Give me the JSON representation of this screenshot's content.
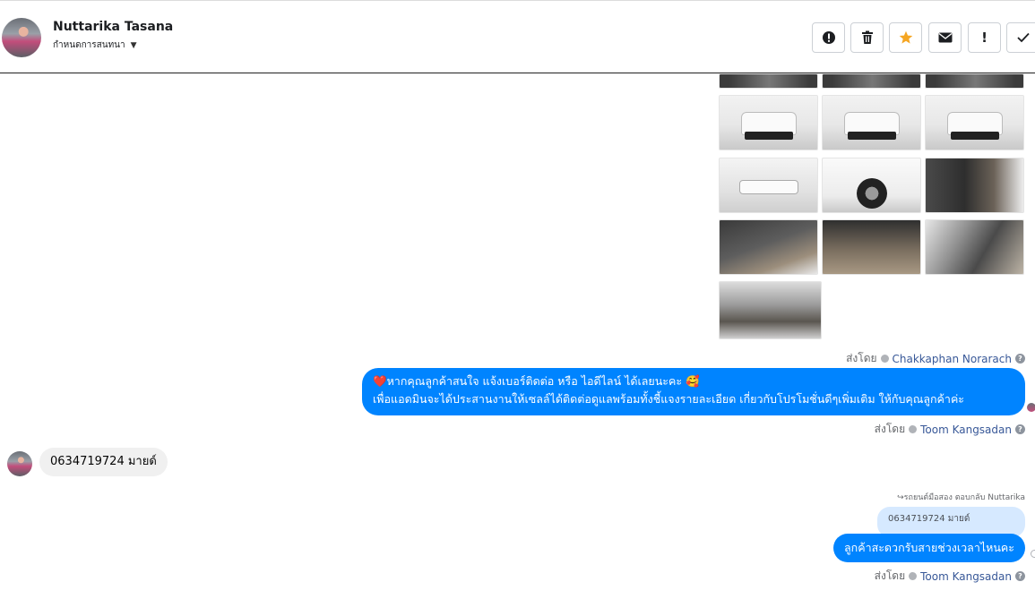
{
  "header": {
    "name": "Nuttarika Tasana",
    "subtitle": "กำหนดการสนทนา",
    "toolbar": [
      "alert-circle",
      "trash",
      "star",
      "envelope",
      "exclamation",
      "check"
    ]
  },
  "gallery": {
    "rows": [
      [
        "partial-truck",
        "partial-truck",
        "partial-truck"
      ],
      [
        "truck-rear",
        "truck-rear",
        "truck-rear"
      ],
      [
        "truck-side",
        "truck-wheel",
        "truck-door"
      ],
      [
        "truck-dashboard",
        "truck-gear",
        "truck-interior"
      ],
      [
        "truck-cab"
      ]
    ]
  },
  "messages": {
    "meta1": {
      "prefix": "ส่งโดย",
      "agent": "Chakkaphan Norarach"
    },
    "out1": {
      "line1": "❤️หากคุณลูกค้าสนใจ แจ้งเบอร์ติดต่อ หรือ ไอดีไลน์ ได้เลยนะคะ 🥰",
      "line2": "เพื่อแอดมินจะได้ประสานงานให้เซลล์ได้ติดต่อดูแลพร้อมทั้งชี้แจงรายละเอียด เกี่ยวกับโปรโมชั่นดีๆเพิ่มเติม ให้กับคุณลูกค้าค่ะ"
    },
    "meta2": {
      "prefix": "ส่งโดย",
      "agent": "Toom Kangsadan"
    },
    "in1": "0634719724 มายด์",
    "reply_header": "↪รถยนต์มือสอง ตอบกลับ Nuttarika",
    "reply_quote": "0634719724 มายด์",
    "out2": "ลูกค้าสะดวกรับสายช่วงเวลาไหนคะ",
    "meta3": {
      "prefix": "ส่งโดย",
      "agent": "Toom Kangsadan"
    }
  },
  "colors": {
    "accent": "#0084ff",
    "star": "#f5a623",
    "link": "#385898"
  }
}
